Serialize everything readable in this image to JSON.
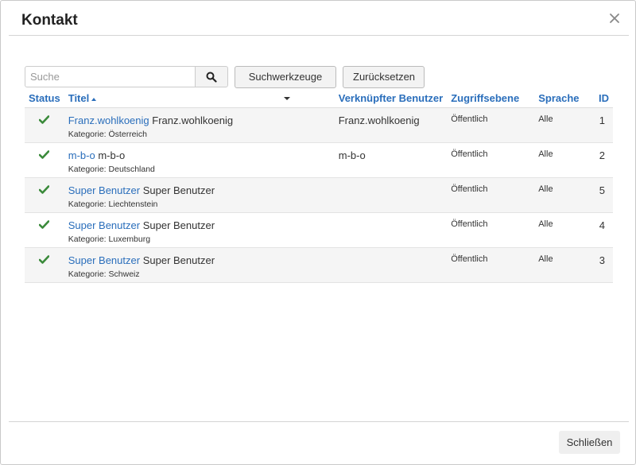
{
  "modal": {
    "title": "Kontakt"
  },
  "toolbar": {
    "search_placeholder": "Suche",
    "tools_label": "Suchwerkzeuge",
    "reset_label": "Zurücksetzen"
  },
  "table": {
    "columns": {
      "status": "Status",
      "titel": "Titel",
      "user": "Verknüpfter Benutzer",
      "access": "Zugriffsebene",
      "lang": "Sprache",
      "id": "ID"
    },
    "rows": [
      {
        "link": "Franz.wohlkoenig",
        "name": "Franz.wohlkoenig",
        "category": "Kategorie: Österreich",
        "user": "Franz.wohlkoenig",
        "access": "Öffentlich",
        "lang": "Alle",
        "id": "1"
      },
      {
        "link": "m-b-o",
        "name": "m-b-o",
        "category": "Kategorie: Deutschland",
        "user": "m-b-o",
        "access": "Öffentlich",
        "lang": "Alle",
        "id": "2"
      },
      {
        "link": "Super Benutzer",
        "name": "Super Benutzer",
        "category": "Kategorie: Liechtenstein",
        "user": "",
        "access": "Öffentlich",
        "lang": "Alle",
        "id": "5"
      },
      {
        "link": "Super Benutzer",
        "name": "Super Benutzer",
        "category": "Kategorie: Luxemburg",
        "user": "",
        "access": "Öffentlich",
        "lang": "Alle",
        "id": "4"
      },
      {
        "link": "Super Benutzer",
        "name": "Super Benutzer",
        "category": "Kategorie: Schweiz",
        "user": "",
        "access": "Öffentlich",
        "lang": "Alle",
        "id": "3"
      }
    ]
  },
  "footer": {
    "close_label": "Schließen"
  },
  "colors": {
    "link": "#2a6ebb",
    "check": "#3a8a3a"
  },
  "icons": {
    "close": "close-icon",
    "search": "search-icon",
    "status": "check-icon"
  }
}
